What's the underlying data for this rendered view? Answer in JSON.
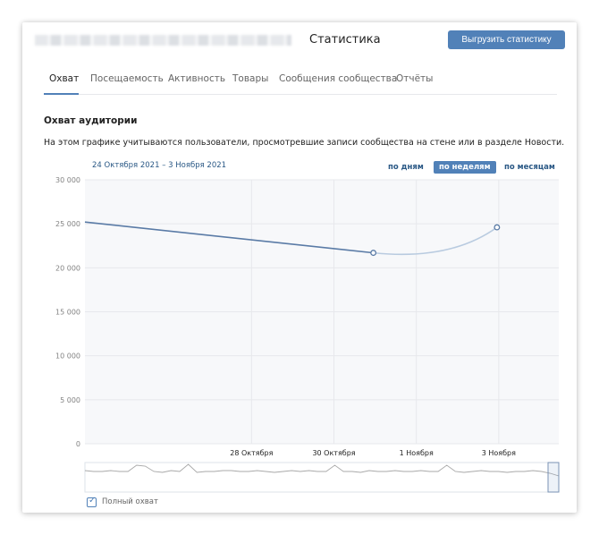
{
  "header": {
    "title": "Статистика",
    "export_label": "Выгрузить статистику"
  },
  "tabs": [
    {
      "label": "Охват",
      "active": true
    },
    {
      "label": "Посещаемость",
      "active": false
    },
    {
      "label": "Активность",
      "active": false
    },
    {
      "label": "Товары",
      "active": false
    },
    {
      "label": "Сообщения сообщества",
      "active": false
    },
    {
      "label": "Отчёты",
      "active": false
    }
  ],
  "section": {
    "title": "Охват аудитории",
    "description": "На этом графике учитываются пользователи, просмотревшие записи сообщества на стене или в разделе Новости."
  },
  "date_range": "24 Октября 2021 – 3 Ноября 2021",
  "periods": [
    {
      "label": "по дням",
      "active": false
    },
    {
      "label": "по неделям",
      "active": true
    },
    {
      "label": "по месяцам",
      "active": false
    }
  ],
  "checkbox": {
    "label": "Полный охват",
    "checked": true
  },
  "colors": {
    "accent": "#5181b8",
    "line": "#5a7ba6",
    "forecast": "#b9cbe0",
    "link": "#2a5885"
  },
  "chart_data": {
    "type": "line",
    "ylim": [
      0,
      30000
    ],
    "y_ticks": [
      "30 000",
      "25 000",
      "20 000",
      "15 000",
      "10 000",
      "5 000",
      "0"
    ],
    "x_ticks": [
      "28 Октября",
      "30 Октября",
      "1 Ноября",
      "3 Ноября"
    ],
    "series": [
      {
        "values": [
          {
            "x": "2021-10-24",
            "y": 25200
          },
          {
            "x": "2021-10-31",
            "y": 21700
          }
        ]
      },
      {
        "values": [
          {
            "x": "2021-10-31",
            "y": 21700
          },
          {
            "x": "2021-11-01",
            "y": 21600
          },
          {
            "x": "2021-11-03",
            "y": 24600
          }
        ]
      }
    ],
    "points": [
      {
        "x": "2021-10-31",
        "y": 21700
      },
      {
        "x": "2021-11-03",
        "y": 24600
      }
    ],
    "grid": true
  }
}
